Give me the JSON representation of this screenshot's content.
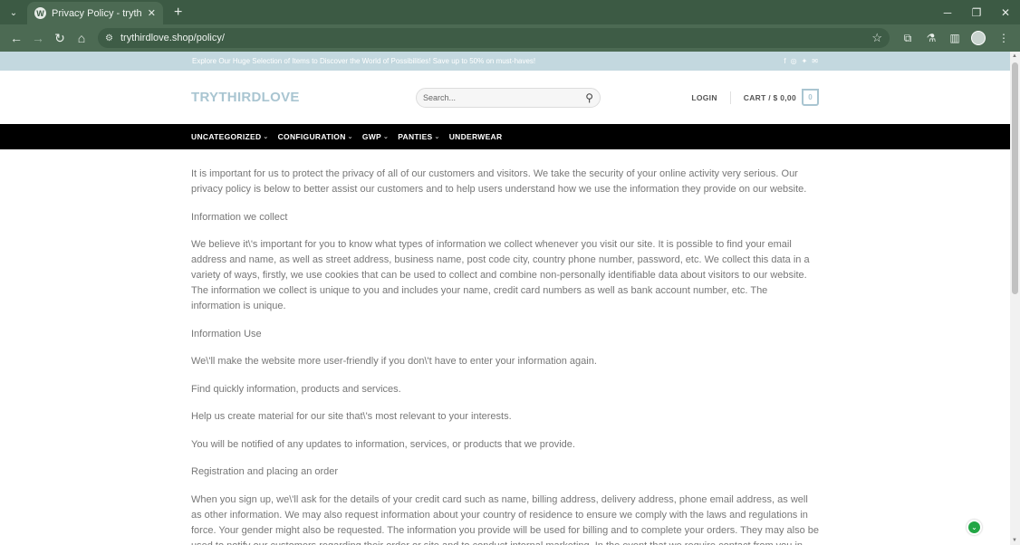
{
  "browser": {
    "tab_title": "Privacy Policy - trythirdlove",
    "url": "trythirdlove.shop/policy/",
    "new_tab_label": "+"
  },
  "site": {
    "promo_text": "Explore Our Huge Selection of Items to Discover the World of Possibilities! Save up to 50% on must-haves!",
    "logo": "TRYTHIRDLOVE",
    "search_placeholder": "Search...",
    "login_label": "LOGIN",
    "cart_label": "CART / $ 0,00",
    "cart_count": "0",
    "nav": [
      {
        "label": "UNCATEGORIZED",
        "caret": true
      },
      {
        "label": "CONFIGURATION",
        "caret": true
      },
      {
        "label": "GWP",
        "caret": true
      },
      {
        "label": "PANTIES",
        "caret": true
      },
      {
        "label": "UNDERWEAR",
        "caret": false
      }
    ]
  },
  "content": {
    "paragraphs": [
      "It is important for us to protect the privacy of all of our customers and visitors. We take the security of your online activity very serious. Our privacy policy is below to better assist our customers and to help users understand how we use the information they provide on our website.",
      "Information we collect",
      "We believe it\\'s important for you to know what types of information we collect whenever you visit our site. It is possible to find your email address and name, as well as street address, business name, post code city, country phone number, password, etc. We collect this data in a variety of ways, firstly, we use cookies that can be used to collect and combine non-personally identifiable data about visitors to our website. The information we collect is unique to you and includes your name, credit card numbers as well as bank account number, etc. The information is unique.",
      "Information Use",
      "We\\'ll make the website more user-friendly if you don\\'t have to enter your information again.",
      "Find quickly information, products and services.",
      "Help us create material for our site that\\'s most relevant to your interests.",
      "You will be notified of any updates to information, services, or products that we provide.",
      "Registration and placing an order",
      "When you sign up, we\\'ll ask for the details of your credit card such as name, billing address, delivery address, phone email address, as well as other information. We may also request information about your country of residence to ensure we comply with the laws and regulations in force. Your gender might also be requested. The information you provide will be used for billing and to complete your orders. They may also be used to notify our customers regarding their order or site and to conduct internal marketing. In the event that we require contact from you in order to resolve"
    ]
  },
  "icons": {
    "social": [
      "facebook-icon",
      "instagram-icon",
      "twitter-icon",
      "email-icon"
    ]
  },
  "colors": {
    "chrome_dark": "#3c5a44",
    "chrome_mid": "#4c6a53",
    "topbar": "#c3d8df",
    "logo": "#a9c5d1",
    "nav_bg": "#000000",
    "body_text": "#777777",
    "float_button": "#22a645"
  }
}
